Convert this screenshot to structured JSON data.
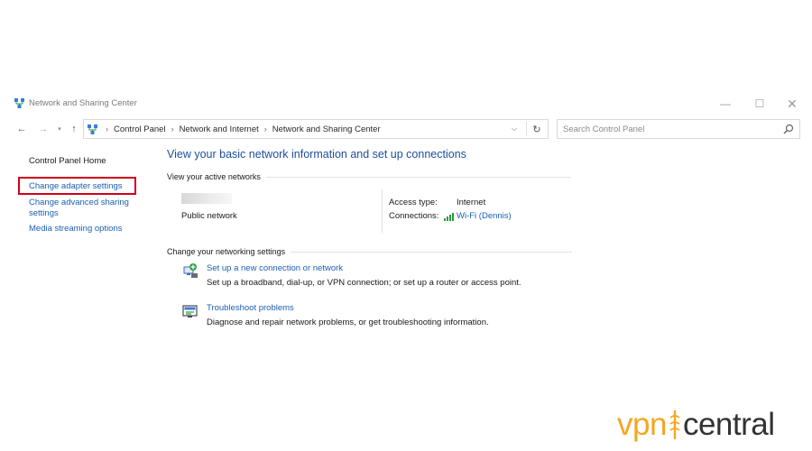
{
  "window": {
    "title": "Network and Sharing Center",
    "controls": {
      "minimize": "—",
      "maximize": "☐",
      "close": "✕"
    }
  },
  "nav": {
    "back": "←",
    "forward": "→",
    "recent": "▾",
    "up": "↑",
    "breadcrumbs": [
      "Control Panel",
      "Network and Internet",
      "Network and Sharing Center"
    ],
    "separator": "›",
    "dropdown": "⌵",
    "refresh": "↻",
    "search_placeholder": "Search Control Panel"
  },
  "sidebar": {
    "home": "Control Panel Home",
    "links": [
      {
        "label": "Change adapter settings",
        "highlighted": true
      },
      {
        "label": "Change advanced sharing settings"
      },
      {
        "label": "Media streaming options"
      }
    ]
  },
  "main": {
    "title": "View your basic network information and set up connections",
    "active_networks_heading": "View your active networks",
    "network": {
      "type": "Public network",
      "access_type_label": "Access type:",
      "access_type_value": "Internet",
      "connections_label": "Connections:",
      "connections_value": "Wi-Fi (Dennis)"
    },
    "change_settings_heading": "Change your networking settings",
    "tasks": [
      {
        "link": "Set up a new connection or network",
        "description": "Set up a broadband, dial-up, or VPN connection; or set up a router or access point.",
        "icon": "network-setup-icon"
      },
      {
        "link": "Troubleshoot problems",
        "description": "Diagnose and repair network problems, or get troubleshooting information.",
        "icon": "troubleshoot-icon"
      }
    ]
  },
  "watermark": {
    "part1": "vpn",
    "part2": "central"
  },
  "colors": {
    "link": "#1a5fb4",
    "title": "#1e4f9c",
    "highlight_border": "#d0021b",
    "watermark_orange": "#f5a623",
    "watermark_dark": "#333333"
  }
}
